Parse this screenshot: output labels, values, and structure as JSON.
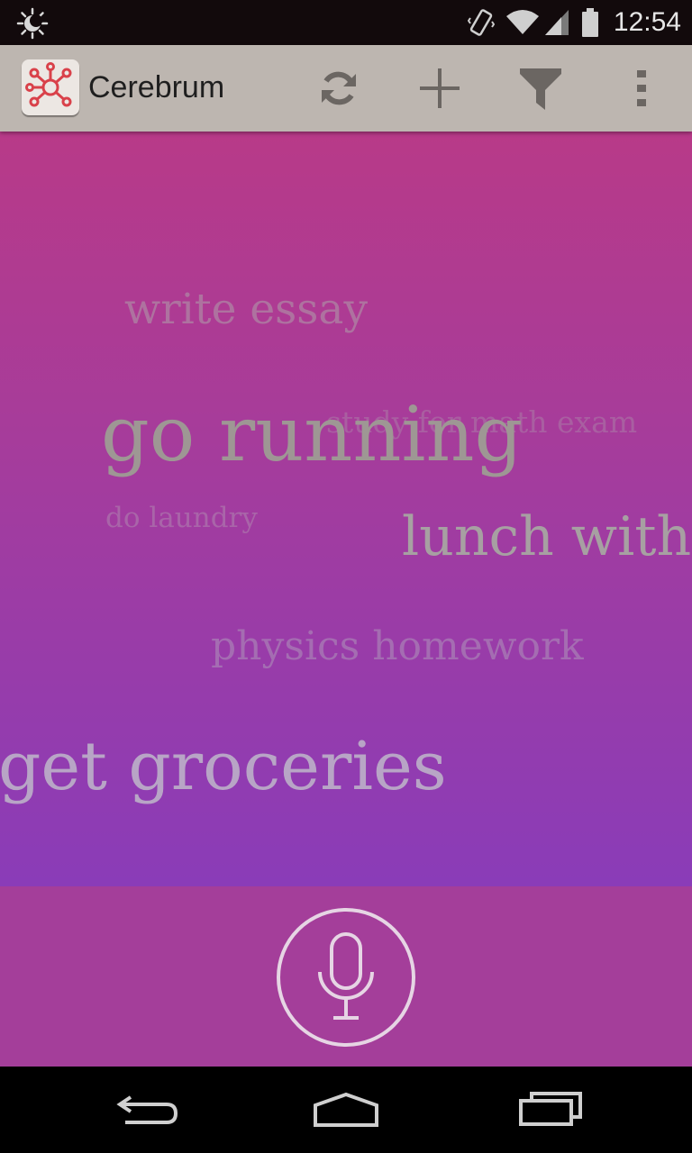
{
  "status_bar": {
    "time": "12:54",
    "icons": [
      "brightness-icon",
      "vibrate-icon",
      "wifi-icon",
      "signal-icon",
      "battery-icon"
    ]
  },
  "action_bar": {
    "title": "Cerebrum",
    "actions": [
      "refresh-icon",
      "add-icon",
      "filter-icon",
      "overflow-menu-icon"
    ]
  },
  "tasks": [
    {
      "label": "write essay"
    },
    {
      "label": "study for math exam"
    },
    {
      "label": "go running"
    },
    {
      "label": "do laundry"
    },
    {
      "label": "lunch with"
    },
    {
      "label": "physics homework"
    },
    {
      "label": "get groceries"
    }
  ],
  "mic": {
    "icon": "microphone-icon"
  },
  "nav_bar": {
    "icons": [
      "back-icon",
      "home-icon",
      "recents-icon"
    ]
  },
  "colors": {
    "status_bar": "#120a0c",
    "action_bar": "#bdb6b0",
    "gradient_top": "#b83a88",
    "gradient_bottom": "#8a3cb8",
    "mic_area": "#a43e9a",
    "logo_accent": "#d9414a"
  }
}
